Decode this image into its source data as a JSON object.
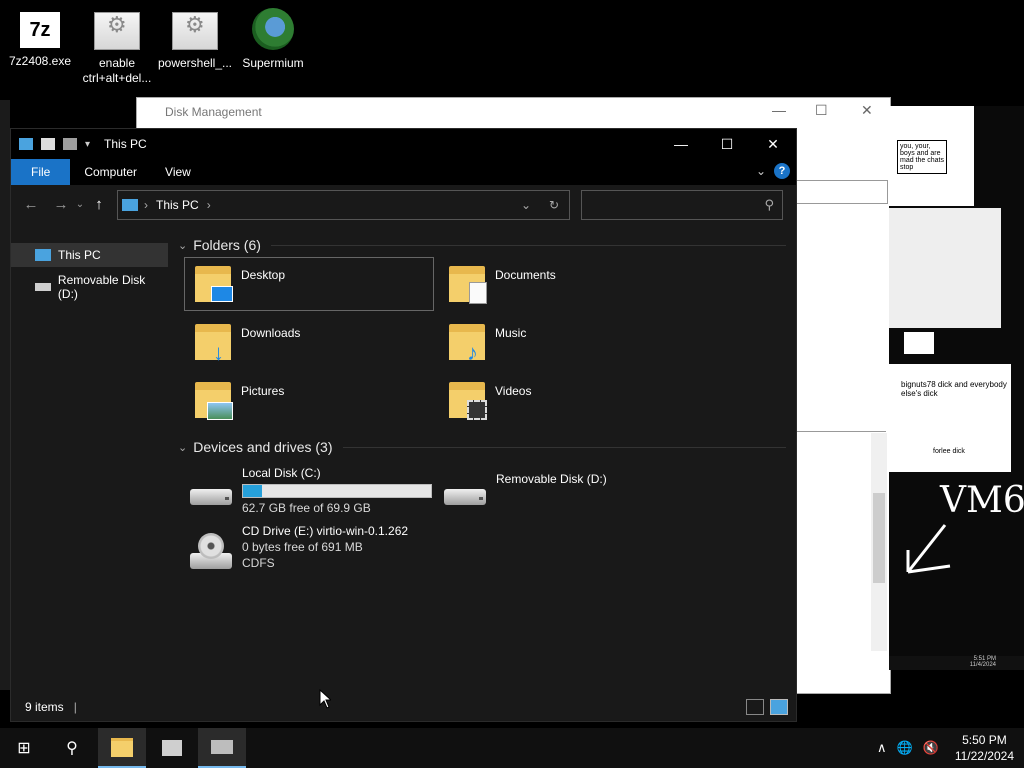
{
  "desktop": {
    "icons": [
      {
        "label": "7z2408.exe",
        "icon": "7zip-icon",
        "badge": "7z"
      },
      {
        "label": "enable ctrl+alt+del...",
        "icon": "shortcut-gear-icon"
      },
      {
        "label": "powershell_...",
        "icon": "shortcut-gear-icon"
      },
      {
        "label": "Supermium",
        "icon": "browser-icon"
      }
    ]
  },
  "disk_management": {
    "title": "Disk Management",
    "controls": {
      "minimize": "—",
      "maximize": "☐",
      "close": "✕"
    }
  },
  "vm_panel": {
    "text": "VM6",
    "note1": "you, your, boys and are mad the chats stop",
    "note2": "bignuts78 dick and everybody else's dick",
    "note3": "forlee dick",
    "tray_time": "5:51 PM",
    "tray_date": "11/4/2024"
  },
  "explorer": {
    "title": "This PC",
    "window_controls": {
      "minimize": "—",
      "maximize": "☐",
      "close": "✕"
    },
    "ribbon": {
      "tabs": [
        "File",
        "Computer",
        "View"
      ],
      "help": "?",
      "expand": "⌄"
    },
    "nav": {
      "back": "←",
      "forward": "→",
      "recent": "⌄",
      "up": "↑",
      "breadcrumb": [
        "This PC"
      ],
      "refresh": "↻",
      "search_placeholder": ""
    },
    "sidebar": [
      {
        "label": "This PC",
        "icon": "computer-icon",
        "selected": true
      },
      {
        "label": "Removable Disk (D:)",
        "icon": "removable-disk-icon",
        "selected": false
      }
    ],
    "folders_header": "Folders (6)",
    "folders": [
      {
        "label": "Desktop",
        "icon": "desktop-folder-icon",
        "focused": true
      },
      {
        "label": "Documents",
        "icon": "documents-folder-icon"
      },
      {
        "label": "Downloads",
        "icon": "downloads-folder-icon"
      },
      {
        "label": "Music",
        "icon": "music-folder-icon"
      },
      {
        "label": "Pictures",
        "icon": "pictures-folder-icon"
      },
      {
        "label": "Videos",
        "icon": "videos-folder-icon"
      }
    ],
    "devices_header": "Devices and drives (3)",
    "drives": [
      {
        "name": "Local Disk (C:)",
        "free": "62.7 GB free of 69.9 GB",
        "used_fraction": 0.103,
        "icon": "hard-drive-icon"
      },
      {
        "name": "Removable Disk (D:)",
        "icon": "removable-disk-icon"
      },
      {
        "name": "CD Drive (E:) virtio-win-0.1.262",
        "free": "0 bytes free of 691 MB",
        "fs": "CDFS",
        "icon": "cd-drive-icon"
      }
    ],
    "status": {
      "count": "9 items",
      "separator": "|"
    }
  },
  "taskbar": {
    "start": "⊞",
    "search": "⚲",
    "apps": [
      {
        "name": "file-explorer",
        "active": true
      },
      {
        "name": "network-app",
        "active": false
      },
      {
        "name": "drive-app",
        "active": true
      }
    ],
    "tray": {
      "chevron": "∧",
      "network": "🌐",
      "volume": "🔇"
    },
    "time": "5:50 PM",
    "date": "11/22/2024"
  },
  "colors": {
    "accent": "#1a73c7",
    "bar_fill": "#26a0da",
    "folder": "#f4cf6b"
  }
}
